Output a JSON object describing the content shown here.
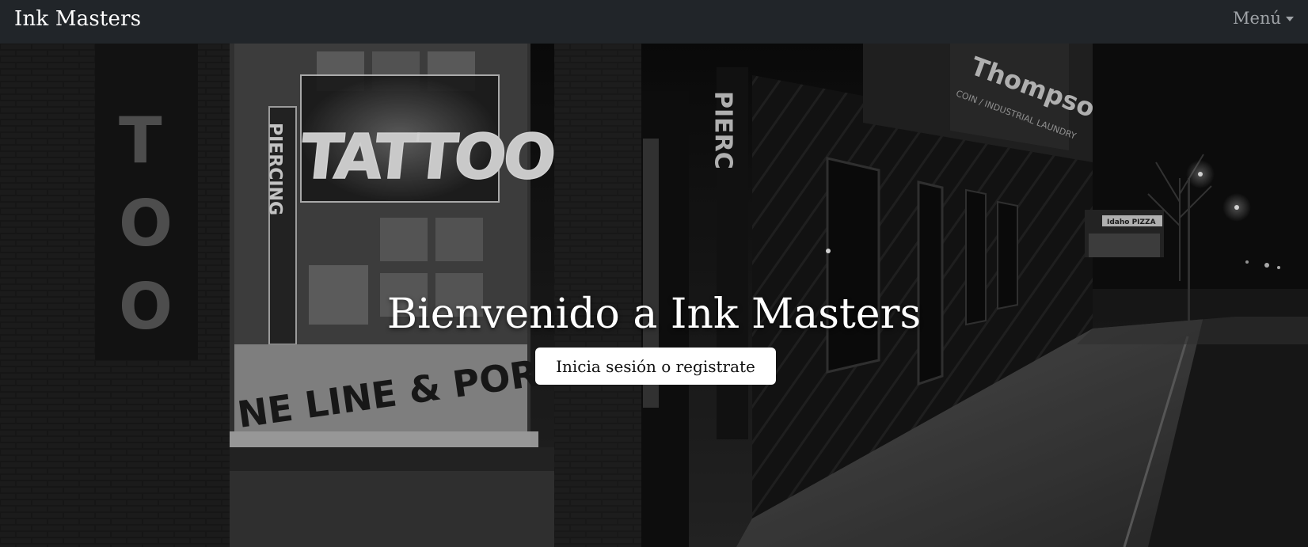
{
  "navbar": {
    "brand": "Ink Masters",
    "menu_label": "Menú",
    "menu_icon": "caret-down-icon"
  },
  "hero": {
    "background": "street-night-photo",
    "neon_sign": "TATTOO",
    "vertical_sign": "PIERCING",
    "window_text": "NE LINE & PORTRAITS",
    "store_sign": "Thompsons",
    "store_subtext": "COIN / INDUSTRIAL LAUNDRY",
    "pizza_sign": "Idaho PIZZA",
    "title": "Bienvenido a Ink Masters",
    "cta_label": "Inicia sesión o registrate"
  },
  "colors": {
    "navbar_bg": "#212529",
    "brand_text": "#ffffff",
    "menu_text": "#a0a4a8",
    "button_bg": "#ffffff"
  }
}
